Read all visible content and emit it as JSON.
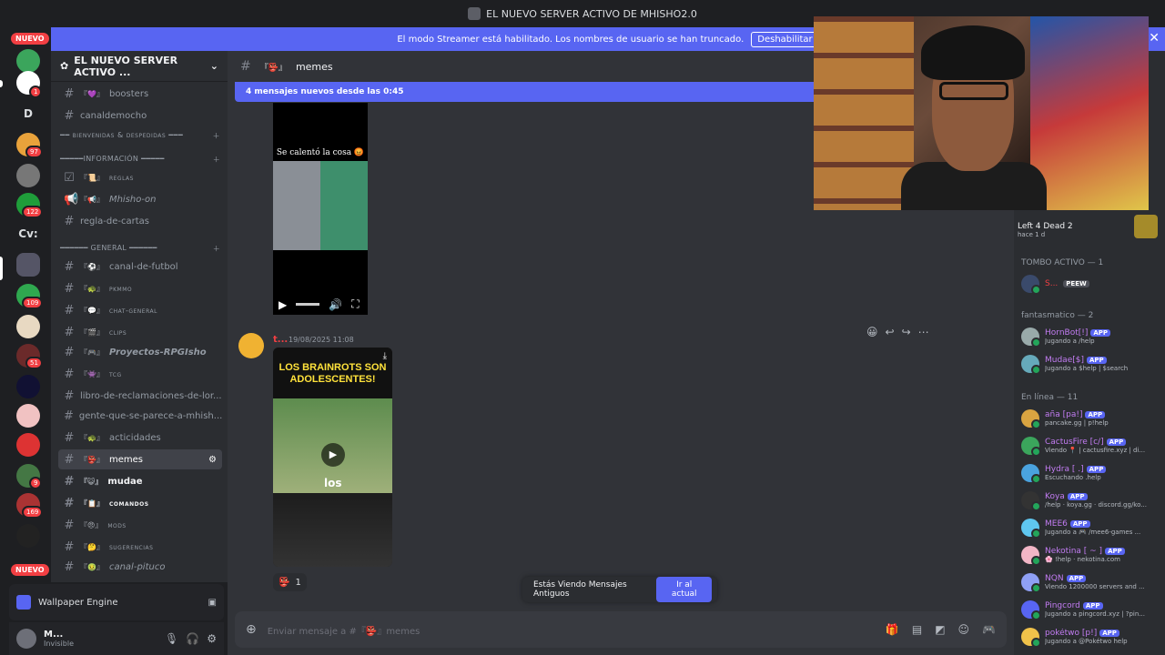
{
  "window": {
    "title": "EL NUEVO SERVER ACTIVO DE MHISHO2.0"
  },
  "streamer_banner": {
    "text": "El modo Streamer está habilitado. Los nombres de usuario se han truncado.",
    "button": "Deshabilitar",
    "close": "✕"
  },
  "rail": {
    "new_top": "NUEVO",
    "new_bottom": "NUEVO",
    "badges": [
      "1",
      "97",
      "122",
      "109",
      "51",
      "9",
      "169"
    ],
    "text_servers": [
      "D",
      "Cv:"
    ]
  },
  "server": {
    "name": "EL NUEVO SERVER ACTIVO ...",
    "dropdown": "⌄"
  },
  "channels": {
    "boosters": "boosters",
    "canaldemocho": "canaldemocho",
    "cat_bienvenidas": "━━ bienvenidas & despedidas ━━━",
    "cat_info": "━━━━━INFORMACIÓN ━━━━━",
    "reglas": "reglas",
    "mhisho_on": "Mhisho-on",
    "regla_cartas": "regla-de-cartas",
    "cat_general": "━━━━━━ GENERAL ━━━━━━",
    "futbol": "canal-de-futbol",
    "pkmmo": "pkmmo",
    "chat_general": "chat-general",
    "clips": "clips",
    "proyectos": "Proyectos-RPGIsho",
    "tcg": "tcg",
    "libro": "libro-de-reclamaciones-de-lor...",
    "gente": "gente-que-se-parece-a-mhish...",
    "acticidades": "acticidades",
    "memes": "memes",
    "mudae": "mudae",
    "comandos": "comandos",
    "mods": "mods",
    "sugerencias": "sugerencias",
    "pituco": "canal-pituco"
  },
  "activity": {
    "label": "Wallpaper Engine"
  },
  "user": {
    "name": "M...",
    "status": "Invisible"
  },
  "chat": {
    "channel_name": "memes",
    "new_messages": "4 mensajes nuevos desde las 0:45",
    "video_caption": "Se calentó la cosa 😡",
    "author": "t...",
    "timestamp": "19/08/2025 11:08",
    "card_title": "LOS BRAINROTS SON ADOLESCENTES!",
    "card_caption": "los",
    "reaction_count": "1",
    "old_messages": "Estás Viendo Mensajes Antiguos",
    "jump_button": "Ir al actual",
    "composer_placeholder": "Enviar mensaje a #『👺』memes"
  },
  "members": {
    "game": {
      "title": "Left 4 Dead 2",
      "when": "hace 1 d"
    },
    "cat_tombo": "TOMBO ACTIVO — 1",
    "tombo_member": {
      "name": "S...",
      "tag": "PEEW"
    },
    "cat_fantasmatico": "fantasmatico — 2",
    "fantasmatico": [
      {
        "name": "HornBot[!]",
        "activity": "Jugando a /help"
      },
      {
        "name": "Mudae[$]",
        "activity": "Jugando a $help | $search"
      }
    ],
    "cat_online": "En línea — 11",
    "online": [
      {
        "name": "aña [pa!]",
        "activity": "pancake.gg | p!help"
      },
      {
        "name": "CactusFire [c/]",
        "activity": "Viendo 📍 | cactusfire.xyz | di..."
      },
      {
        "name": "Hydra [ .]",
        "activity": "Escuchando .help"
      },
      {
        "name": "Koya",
        "activity": "/help · koya.gg · discord.gg/ko..."
      },
      {
        "name": "MEE6",
        "activity": "Jugando a 🎮 /mee6-games ..."
      },
      {
        "name": "Nekotina [ ~ ]",
        "activity": "🌸 !help · nekotina.com"
      },
      {
        "name": "NQN",
        "activity": "Viendo 1200000 servers and ..."
      },
      {
        "name": "Pingcord",
        "activity": "Jugando a pingcord.xyz | ?pin..."
      },
      {
        "name": "pokétwo [p!]",
        "activity": "Jugando a @Pokétwo help"
      }
    ],
    "app_label": "APP"
  },
  "colors": {
    "accent": "#5865f2",
    "danger": "#f23f43",
    "online": "#23a55a"
  }
}
